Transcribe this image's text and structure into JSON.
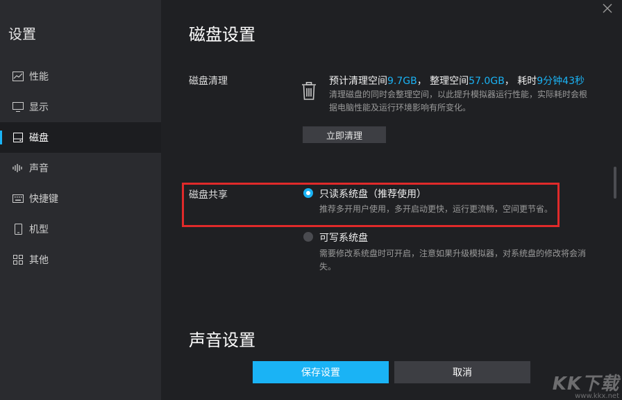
{
  "sidebar": {
    "title": "设置",
    "items": [
      {
        "label": "性能",
        "icon": "chart-icon"
      },
      {
        "label": "显示",
        "icon": "monitor-icon"
      },
      {
        "label": "磁盘",
        "icon": "disk-icon",
        "active": true
      },
      {
        "label": "声音",
        "icon": "sound-wave-icon"
      },
      {
        "label": "快捷键",
        "icon": "keyboard-icon"
      },
      {
        "label": "机型",
        "icon": "phone-icon"
      },
      {
        "label": "其他",
        "icon": "grid-icon"
      }
    ]
  },
  "main": {
    "title": "磁盘设置",
    "disk_clean": {
      "label": "磁盘清理",
      "stat_prefix1": "预计清理空间",
      "stat_value1": "9.7GB",
      "stat_sep1": "，",
      "stat_prefix2": "整理空间",
      "stat_value2": "57.0GB",
      "stat_sep2": "，",
      "stat_prefix3": "耗时",
      "stat_value3": "9分钟43秒",
      "desc_line1": "清理磁盘的同时会整理空间，以此提升模拟器运行性能，实际耗时会根",
      "desc_line2": "据电脑性能及运行环境影响有所变化。",
      "button": "立即清理"
    },
    "disk_share": {
      "label": "磁盘共享",
      "options": [
        {
          "label": "只读系统盘（推荐使用）",
          "desc": "推荐多开用户使用，多开启动更快，运行更流畅，空间更节省。",
          "selected": true
        },
        {
          "label": "可写系统盘",
          "desc_line1": "需要修改系统盘时可开启，注意如果升级模拟器，对系统盘的修改将会消",
          "desc_line2": "失。",
          "selected": false
        }
      ]
    },
    "sound_title": "声音设置"
  },
  "footer": {
    "save": "保存设置",
    "cancel": "取消"
  },
  "watermark": {
    "big": "KK下载",
    "small": "www.kkx.net"
  },
  "colors": {
    "accent": "#1ab3f5",
    "highlight_box": "#e02a2a"
  }
}
